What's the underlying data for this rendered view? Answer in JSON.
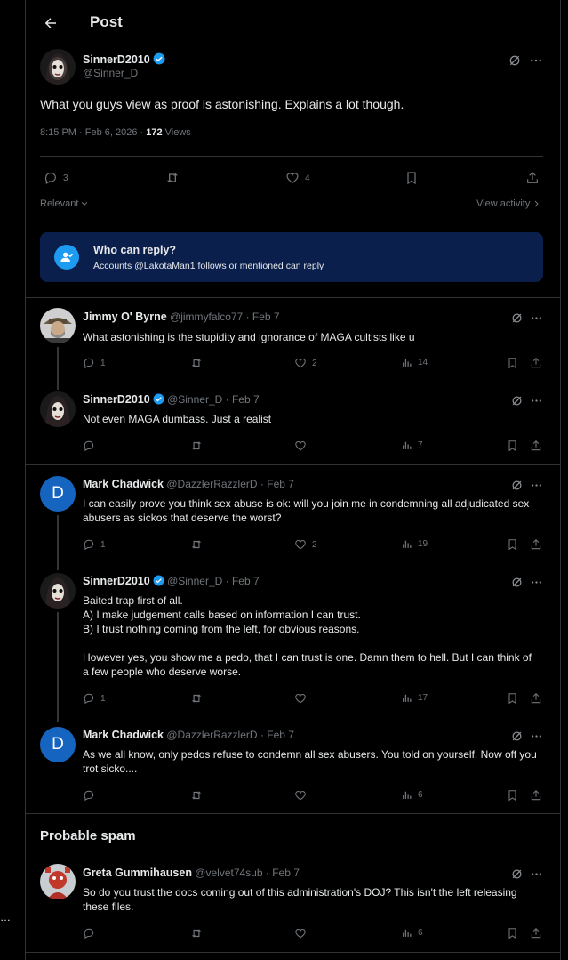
{
  "header": {
    "title": "Post"
  },
  "main_post": {
    "author": "SinnerD2010",
    "handle": "@Sinner_D",
    "text": "What you guys view as proof is astonishing. Explains a lot though.",
    "timestamp": "8:15 PM · Feb 6, 2026 · ",
    "views": "172",
    "views_label": "Views",
    "replies": "3",
    "likes": "4",
    "sort_label": "Relevant",
    "view_activity": "View activity"
  },
  "reply_restriction": {
    "title": "Who can reply?",
    "text": "Accounts @LakotaMan1 follows or mentioned can reply"
  },
  "replies": [
    {
      "author": "Jimmy O' Byrne",
      "handle": "@jimmyfalco77",
      "date": "· Feb 7",
      "text": "What astonishing is the stupidity and ignorance of MAGA cultists like u",
      "replies": "1",
      "likes": "2",
      "views": "14"
    },
    {
      "author": "SinnerD2010",
      "handle": "@Sinner_D",
      "date": "· Feb 7",
      "text": "Not even MAGA dumbass. Just a realist",
      "replies": "",
      "likes": "",
      "views": "7"
    },
    {
      "author": "Mark Chadwick",
      "handle": "@DazzlerRazzlerD",
      "date": "· Feb 7",
      "text": "I can easily prove you think sex abuse is ok: will you join me in condemning all adjudicated sex abusers as sickos that deserve the worst?",
      "replies": "1",
      "likes": "2",
      "views": "19",
      "avatar_letter": "D"
    },
    {
      "author": "SinnerD2010",
      "handle": "@Sinner_D",
      "date": "· Feb 7",
      "lines": [
        "Baited trap first of all.",
        "A) I make judgement calls based on information I can trust.",
        "B) I trust nothing coming from the left, for obvious reasons.",
        "",
        "However yes, you show me a pedo, that I can trust is one. Damn them to hell. But I can think of a few people who deserve worse."
      ],
      "replies": "1",
      "likes": "",
      "views": "17"
    },
    {
      "author": "Mark Chadwick",
      "handle": "@DazzlerRazzlerD",
      "date": "· Feb 7",
      "text": "As we all know, only pedos refuse to condemn all sex abusers. You told on yourself. Now off you trot sicko....",
      "replies": "",
      "likes": "",
      "views": "6",
      "avatar_letter": "D"
    }
  ],
  "spam_section": {
    "title": "Probable spam",
    "reply": {
      "author": "Greta Gummihausen",
      "handle": "@velvet74sub",
      "date": "· Feb 7",
      "text": "So do you trust the docs coming out of this administration's DOJ? This isn't the left releasing these files.",
      "replies": "",
      "likes": "",
      "views": "6"
    }
  },
  "side_dots": "…",
  "colors": {
    "accent": "#1d9bf0",
    "verified": "#1d9bf0",
    "reply_box": "#0b1f4d",
    "border": "#2f3336",
    "muted": "#71767b"
  }
}
